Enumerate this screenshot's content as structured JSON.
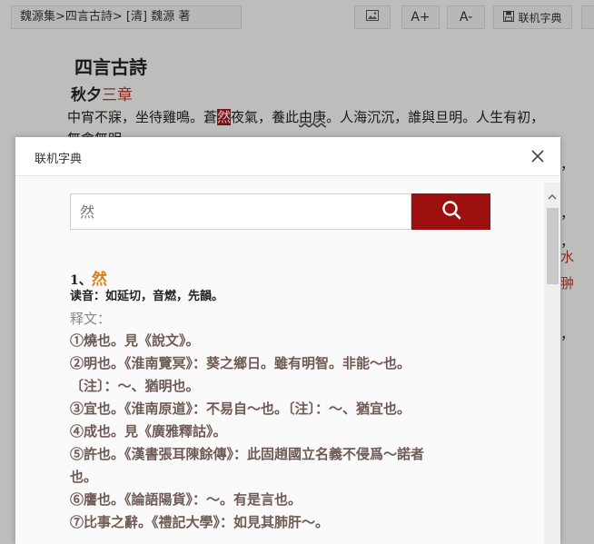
{
  "toolbar": {
    "breadcrumb": "魏源集>四言古詩> [清] 魏源 著",
    "image_button_icon": "image-icon",
    "font_increase_label": "A+",
    "font_decrease_label": "A-",
    "dictionary_label": "联机字典"
  },
  "reader": {
    "poem_title": "四言古詩",
    "chapter_prefix": "秋夕",
    "chapter_suffix": "三章",
    "line1": {
      "part1": "中宵不寐，坐待雞鳴。蒼",
      "highlighted": "然",
      "part2": "夜氣，養此",
      "underlined": "由庚",
      "part3": "。人海沉沉，誰與旦明。人生有初，"
    },
    "line2": "無會無明",
    "edge_glyphs": [
      "，",
      "，",
      "，",
      "水",
      "翀",
      "，"
    ]
  },
  "dialog": {
    "title": "联机字典",
    "search_placeholder": "然",
    "entry": {
      "index": "1、",
      "character": "然",
      "reading": "读音：如延切，音燃，先韻。",
      "gloss_label": "释文：",
      "definitions": [
        "①燒也。見《說文》。",
        "②明也。《淮南覽冥》：葵之鄉日。雖有明智。非能～也。",
        "〔注〕：～、猶明也。",
        "③宜也。《淮南原道》：不易自～也。〔注〕：～、猶宜也。",
        "④成也。見《廣雅釋詁》。",
        "⑤許也。《漢書張耳陳餘傳》：此固趙國立名義不侵爲～諾者",
        "也。",
        "⑥譍也。《論語陽貨》：～。有是言也。",
        "⑦比事之辭。《禮記大學》：如見其肺肝～。"
      ]
    }
  },
  "colors": {
    "accent_red": "#9c1010",
    "highlight": "#a3121b",
    "entry_char": "#d4821c",
    "definition_text": "#6f5a55"
  }
}
